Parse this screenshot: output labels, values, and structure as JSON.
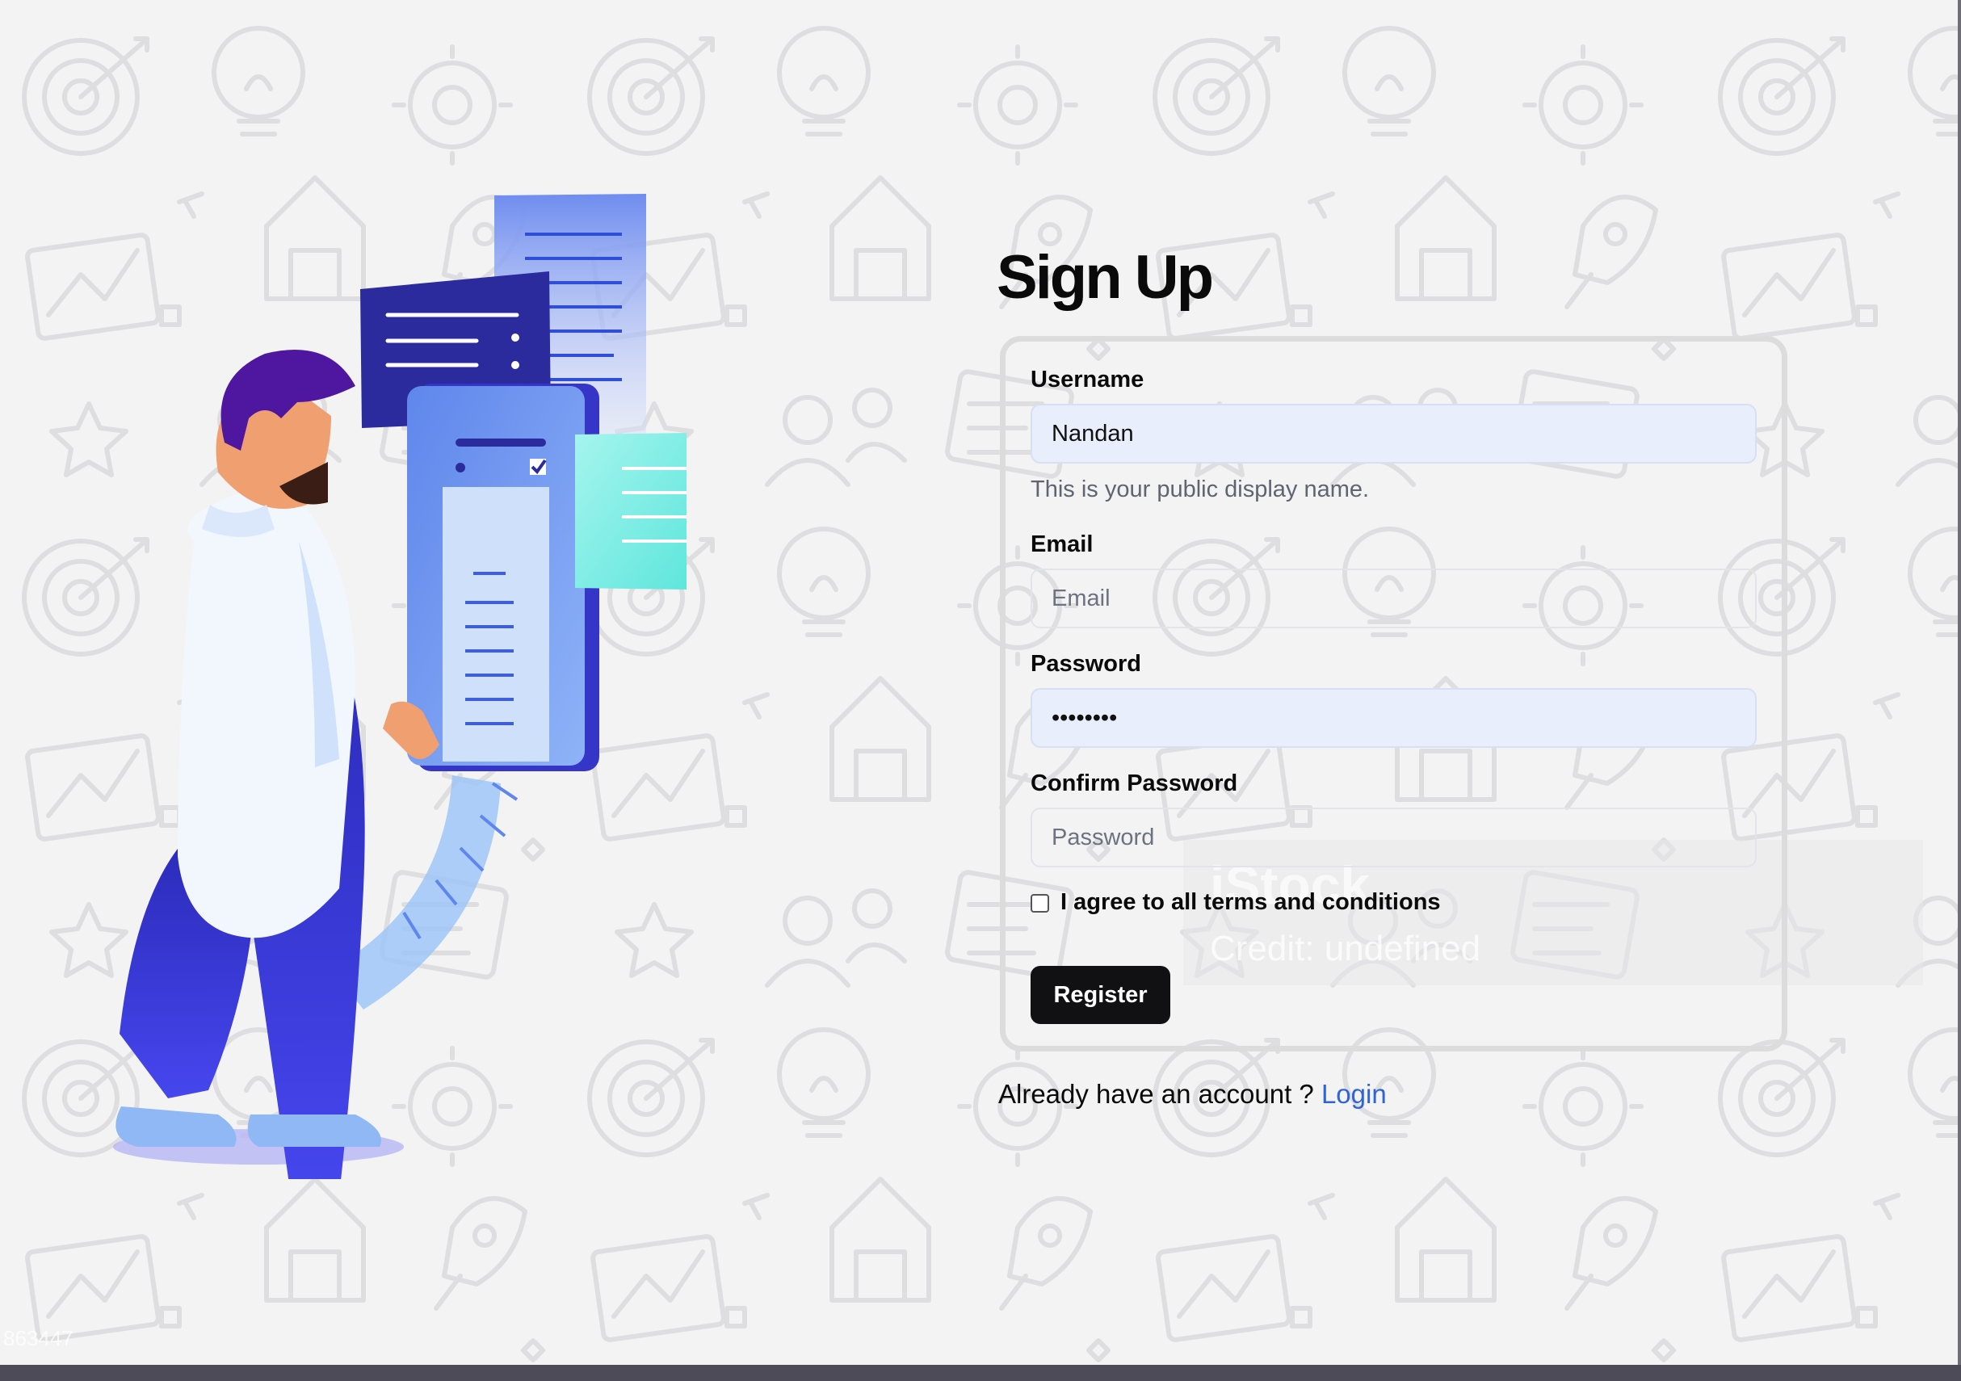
{
  "page": {
    "title": "Sign Up"
  },
  "form": {
    "username": {
      "label": "Username",
      "value": "Nandan",
      "hint": "This is your public display name."
    },
    "email": {
      "label": "Email",
      "value": "",
      "placeholder": "Email"
    },
    "password": {
      "label": "Password",
      "value": "12345678"
    },
    "confirm_password": {
      "label": "Confirm Password",
      "value": "",
      "placeholder": "Password"
    },
    "terms": {
      "label": "I agree to all terms and conditions",
      "checked": false
    },
    "register_label": "Register"
  },
  "footer": {
    "prompt": "Already have an account ? ",
    "login_label": "Login"
  },
  "watermark": {
    "title": "iStock",
    "credit": "Credit: undefined",
    "dimensions": "863447"
  },
  "colors": {
    "background": "#f3f3f4",
    "pattern_stroke": "#dedee0",
    "accent_link": "#2f63d6",
    "button_bg": "#111113",
    "autofill_bg": "#e8eefb",
    "illustration_primary": "#3f3fd8",
    "illustration_teal": "#7ef0e6"
  },
  "icons": {
    "background_pattern": "doodle-pattern-icons",
    "terms_checkbox": "checkbox-unchecked"
  }
}
